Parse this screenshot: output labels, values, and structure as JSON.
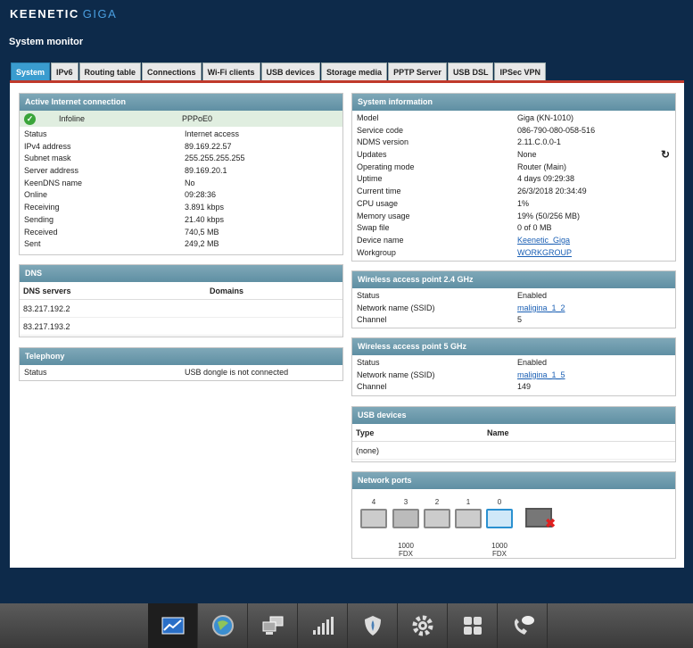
{
  "brand": {
    "name": "KEENETIC",
    "model": "GIGA"
  },
  "page_title": "System monitor",
  "tabs": [
    "System",
    "IPv6",
    "Routing table",
    "Connections",
    "Wi-Fi clients",
    "USB devices",
    "Storage media",
    "PPTP Server",
    "USB DSL",
    "IPSec VPN"
  ],
  "internet": {
    "title": "Active Internet connection",
    "name": "Infoline",
    "type": "PPPoE0",
    "rows": [
      [
        "Status",
        "Internet access"
      ],
      [
        "IPv4 address",
        "89.169.22.57"
      ],
      [
        "Subnet mask",
        "255.255.255.255"
      ],
      [
        "Server address",
        "89.169.20.1"
      ],
      [
        "KeenDNS name",
        "No"
      ],
      [
        "Online",
        "09:28:36"
      ],
      [
        "Receiving",
        "3.891 kbps"
      ],
      [
        "Sending",
        "21.40 kbps"
      ],
      [
        "Received",
        "740,5 MB"
      ],
      [
        "Sent",
        "249,2 MB"
      ]
    ]
  },
  "dns": {
    "title": "DNS",
    "col_servers": "DNS servers",
    "col_domains": "Domains",
    "servers": [
      "83.217.192.2",
      "83.217.193.2"
    ]
  },
  "telephony": {
    "title": "Telephony",
    "status_label": "Status",
    "status_value": "USB dongle is not connected"
  },
  "sysinfo": {
    "title": "System information",
    "rows": [
      [
        "Model",
        "Giga (KN-1010)"
      ],
      [
        "Service code",
        "086-790-080-058-516"
      ],
      [
        "NDMS version",
        "2.11.C.0.0-1"
      ],
      [
        "Updates",
        "None"
      ],
      [
        "Operating mode",
        "Router (Main)"
      ],
      [
        "Uptime",
        "4 days 09:29:38"
      ],
      [
        "Current time",
        "26/3/2018 20:34:49"
      ],
      [
        "CPU usage",
        "1%"
      ],
      [
        "Memory usage",
        "19% (50/256 MB)"
      ],
      [
        "Swap file",
        "0 of 0 MB"
      ]
    ],
    "device_name_label": "Device name",
    "device_name": "Keenetic_Giga",
    "workgroup_label": "Workgroup",
    "workgroup": "WORKGROUP"
  },
  "wifi24": {
    "title": "Wireless access point 2.4 GHz",
    "status_label": "Status",
    "status": "Enabled",
    "ssid_label": "Network name (SSID)",
    "ssid": "maligina_1_2",
    "channel_label": "Channel",
    "channel": "5"
  },
  "wifi5": {
    "title": "Wireless access point 5 GHz",
    "status_label": "Status",
    "status": "Enabled",
    "ssid_label": "Network name (SSID)",
    "ssid": "maligina_1_5",
    "channel_label": "Channel",
    "channel": "149"
  },
  "usb": {
    "title": "USB devices",
    "col_type": "Type",
    "col_name": "Name",
    "empty": "(none)"
  },
  "ports": {
    "title": "Network ports",
    "labels": [
      "4",
      "3",
      "2",
      "1",
      "0"
    ],
    "port3_speed": "1000",
    "port3_duplex": "FDX",
    "port0_speed": "1000",
    "port0_duplex": "FDX"
  },
  "nav_icons": [
    "monitor-icon",
    "internet-globe-icon",
    "home-network-icon",
    "wifi-signal-icon",
    "security-shield-icon",
    "settings-gear-icon",
    "apps-grid-icon",
    "phone-icon"
  ]
}
